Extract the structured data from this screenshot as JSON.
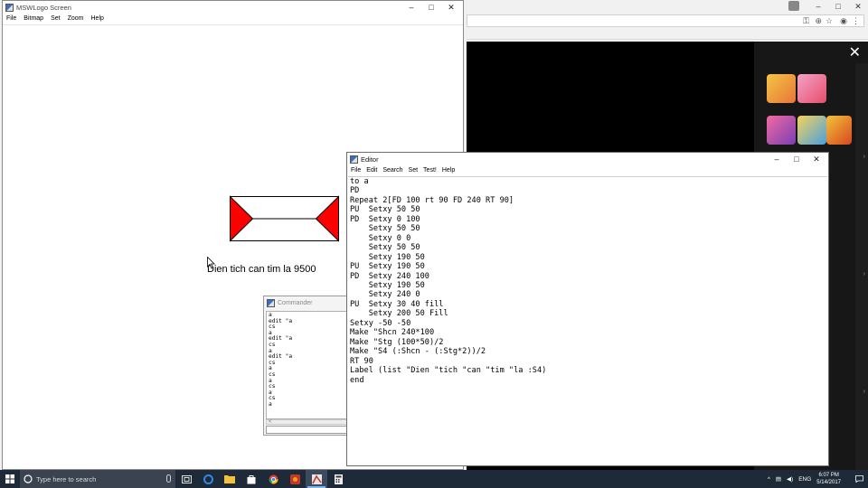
{
  "browser": {
    "window_controls": [
      "–",
      "□",
      "✕"
    ],
    "overlay_close": "✕"
  },
  "logo_window": {
    "title": "MSWLogo Screen",
    "controls": [
      "–",
      "□",
      "✕"
    ],
    "menu": [
      "File",
      "Bitmap",
      "Set",
      "Zoom",
      "Help"
    ],
    "canvas_label": "Dien tich can tim la 9500",
    "fill_color": "#ff0000"
  },
  "commander": {
    "title": "Commander",
    "history": [
      "a",
      "edit \"a",
      "cs",
      "a",
      "edit \"a",
      "cs",
      "a",
      "edit \"a",
      "cs",
      "a",
      "cs",
      "a",
      "cs",
      "a",
      "cs",
      "a"
    ],
    "scroll_left": "<"
  },
  "editor": {
    "title": "Editor",
    "controls": [
      "–",
      "□",
      "✕"
    ],
    "menu": [
      "File",
      "Edit",
      "Search",
      "Set",
      "Test!",
      "Help"
    ],
    "code": "to a\nPD\nRepeat 2[FD 100 rt 90 FD 240 RT 90]\nPU  Setxy 50 50\nPD  Setxy 0 100\n    Setxy 50 50\n    Setxy 0 0\n    Setxy 50 50\n    Setxy 190 50\nPU  Setxy 190 50\nPD  Setxy 240 100\n    Setxy 190 50\n    Setxy 240 0\nPU  Setxy 30 40 fill\n    Setxy 200 50 Fill\nSetxy -50 -50\nMake \"Shcn 240*100\nMake \"Stg (100*50)/2\nMake \"S4 (:Shcn - (:Stg*2))/2\nRT 90\nLabel (list \"Dien \"tich \"can \"tim \"la :S4)\nend"
  },
  "taskbar": {
    "search_placeholder": "Type here to search",
    "language": "ENG",
    "time": "6:07 PM",
    "date": "5/14/2017",
    "tray_up": "^"
  }
}
